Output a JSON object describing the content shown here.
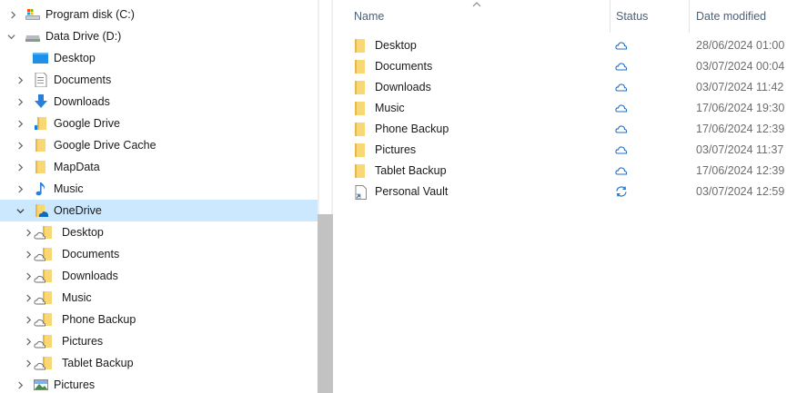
{
  "nav": {
    "items": [
      {
        "label": "Program disk (C:)",
        "icon": "drive-c-icon",
        "expand": "expanded-partial"
      },
      {
        "label": "Data Drive (D:)",
        "icon": "drive-icon",
        "expand": "expanded"
      },
      {
        "label": "Desktop",
        "icon": "desktop-icon",
        "expand": "none"
      },
      {
        "label": "Documents",
        "icon": "documents-icon",
        "expand": "collapsed"
      },
      {
        "label": "Downloads",
        "icon": "downloads-icon",
        "expand": "collapsed"
      },
      {
        "label": "Google Drive",
        "icon": "google-drive-folder-icon",
        "expand": "collapsed"
      },
      {
        "label": "Google Drive Cache",
        "icon": "folder-icon",
        "expand": "collapsed"
      },
      {
        "label": "MapData",
        "icon": "folder-icon",
        "expand": "collapsed"
      },
      {
        "label": "Music",
        "icon": "music-icon",
        "expand": "collapsed"
      },
      {
        "label": "OneDrive",
        "icon": "onedrive-folder-icon",
        "expand": "expanded",
        "selected": true
      },
      {
        "label": "Desktop",
        "icon": "cloud-folder-icon",
        "expand": "collapsed",
        "child": true
      },
      {
        "label": "Documents",
        "icon": "cloud-folder-icon",
        "expand": "collapsed",
        "child": true
      },
      {
        "label": "Downloads",
        "icon": "cloud-folder-icon",
        "expand": "collapsed",
        "child": true
      },
      {
        "label": "Music",
        "icon": "cloud-folder-icon",
        "expand": "collapsed",
        "child": true
      },
      {
        "label": "Phone Backup",
        "icon": "cloud-folder-icon",
        "expand": "collapsed",
        "child": true
      },
      {
        "label": "Pictures",
        "icon": "cloud-folder-icon",
        "expand": "collapsed",
        "child": true
      },
      {
        "label": "Tablet Backup",
        "icon": "cloud-folder-icon",
        "expand": "collapsed",
        "child": true
      },
      {
        "label": "Pictures",
        "icon": "pictures-icon",
        "expand": "collapsed"
      }
    ]
  },
  "columns": {
    "name": "Name",
    "status": "Status",
    "date": "Date modified",
    "sort": "ascending"
  },
  "files": [
    {
      "name": "Desktop",
      "type": "folder",
      "status": "cloud-icon",
      "date": "28/06/2024 01:00"
    },
    {
      "name": "Documents",
      "type": "folder",
      "status": "cloud-icon",
      "date": "03/07/2024 00:04"
    },
    {
      "name": "Downloads",
      "type": "folder",
      "status": "cloud-icon",
      "date": "03/07/2024 11:42"
    },
    {
      "name": "Music",
      "type": "folder",
      "status": "cloud-icon",
      "date": "17/06/2024 19:30"
    },
    {
      "name": "Phone Backup",
      "type": "folder",
      "status": "cloud-icon",
      "date": "17/06/2024 12:39"
    },
    {
      "name": "Pictures",
      "type": "folder",
      "status": "cloud-icon",
      "date": "03/07/2024 11:37"
    },
    {
      "name": "Tablet Backup",
      "type": "folder",
      "status": "cloud-icon",
      "date": "17/06/2024 12:39"
    },
    {
      "name": "Personal Vault",
      "type": "shortcut",
      "status": "sync-icon",
      "date": "03/07/2024 12:59"
    }
  ],
  "colors": {
    "selection": "#cce8ff",
    "folder": "#f8d775",
    "folder_dark": "#e8b84a",
    "status_icon": "#1f6fc5",
    "header_text": "#4c607a",
    "date_text": "#6d6d6d"
  }
}
